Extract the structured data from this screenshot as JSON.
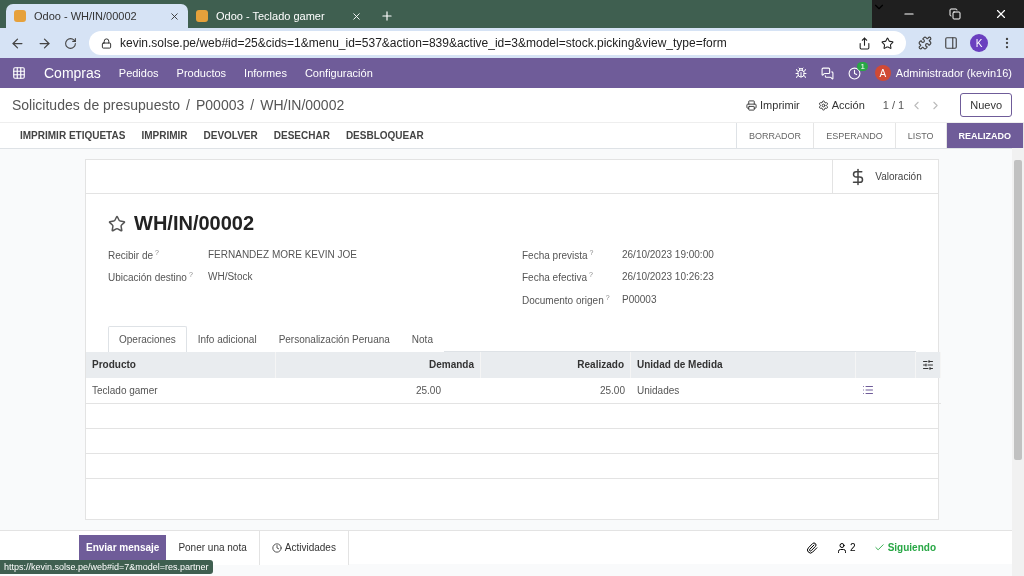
{
  "browser": {
    "tabs": [
      {
        "title": "Odoo - WH/IN/00002",
        "selected": true
      },
      {
        "title": "Odoo - Teclado gamer",
        "selected": false
      }
    ],
    "url": "kevin.solse.pe/web#id=25&cids=1&menu_id=537&action=839&active_id=3&model=stock.picking&view_type=form",
    "profile": "K"
  },
  "navbar": {
    "app": "Compras",
    "menu": [
      "Pedidos",
      "Productos",
      "Informes",
      "Configuración"
    ],
    "activity_count": "1",
    "avatar": "A",
    "user": "Administrador (kevin16)"
  },
  "breadcrumb": [
    "Solicitudes de presupuesto",
    "P00003",
    "WH/IN/00002"
  ],
  "breadcrumb_separator": "/",
  "help_mark": "?",
  "control": {
    "print": "Imprimir",
    "action": "Acción",
    "pager": "1 / 1",
    "new": "Nuevo"
  },
  "actions": [
    "IMPRIMIR ETIQUETAS",
    "IMPRIMIR",
    "DEVOLVER",
    "DESECHAR",
    "DESBLOQUEAR"
  ],
  "statusbar": [
    {
      "label": "BORRADOR",
      "selected": false
    },
    {
      "label": "ESPERANDO",
      "selected": false
    },
    {
      "label": "LISTO",
      "selected": false
    },
    {
      "label": "REALIZADO",
      "selected": true
    }
  ],
  "smart_button": "Valoración",
  "record": {
    "title": "WH/IN/00002",
    "starred": false
  },
  "fields_left": [
    {
      "label": "Recibir de",
      "value": "FERNANDEZ MORE KEVIN JOE"
    },
    {
      "label": "Ubicación destino",
      "value": "WH/Stock"
    }
  ],
  "fields_right": [
    {
      "label": "Fecha prevista",
      "value": "26/10/2023 19:00:00"
    },
    {
      "label": "Fecha efectiva",
      "value": "26/10/2023 10:26:23"
    },
    {
      "label": "Documento origen",
      "value": "P00003"
    }
  ],
  "notebook": [
    {
      "label": "Operaciones",
      "selected": true
    },
    {
      "label": "Info adicional",
      "selected": false
    },
    {
      "label": "Personalización Peruana",
      "selected": false
    },
    {
      "label": "Nota",
      "selected": false
    }
  ],
  "table": {
    "columns": [
      "Producto",
      "Demanda",
      "Realizado",
      "Unidad de Medida"
    ],
    "rows": [
      {
        "product": "Teclado gamer",
        "demand": "25.00",
        "done": "25.00",
        "uom": "Unidades"
      }
    ]
  },
  "chatter": {
    "send": "Enviar mensaje",
    "note": "Poner una nota",
    "activities": "Actividades",
    "followers": "2",
    "following": "Siguiendo"
  },
  "status_url": "https://kevin.solse.pe/web#id=7&model=res.partner"
}
